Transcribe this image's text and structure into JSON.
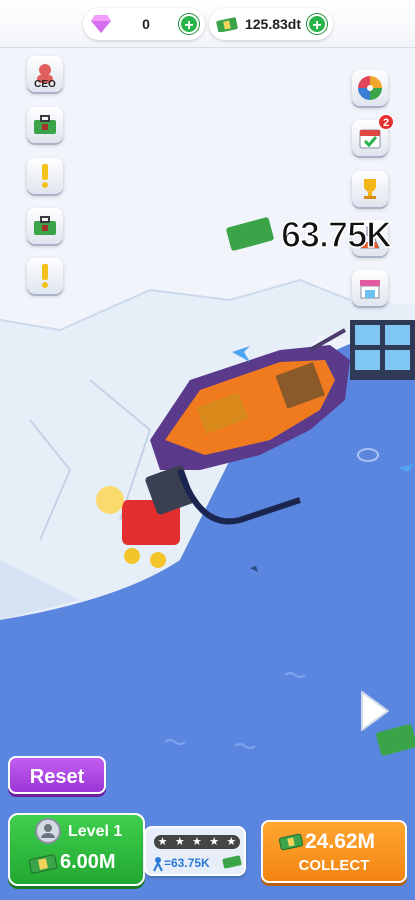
{
  "currency": {
    "gems": "0",
    "cash": "125.83dt",
    "gem_icon": "diamond-icon",
    "cash_icon": "cash-stack-icon"
  },
  "side_left": [
    {
      "name": "ceo-button",
      "label": "CEO"
    },
    {
      "name": "briefcase-button-1",
      "icon": "briefcase-icon"
    },
    {
      "name": "alert-button-1",
      "icon": "exclamation-icon"
    },
    {
      "name": "briefcase-button-2",
      "icon": "briefcase-icon"
    },
    {
      "name": "alert-button-2",
      "icon": "exclamation-icon"
    }
  ],
  "side_right": [
    {
      "name": "wheel-button",
      "icon": "prize-wheel-icon"
    },
    {
      "name": "calendar-button",
      "icon": "calendar-check-icon",
      "badge": "2"
    },
    {
      "name": "trophy-button",
      "icon": "trophy-icon"
    },
    {
      "name": "lab-button",
      "icon": "flask-icon"
    },
    {
      "name": "shop-button",
      "icon": "shop-icon"
    }
  ],
  "floating_income": "63.75K",
  "reset_label": "Reset",
  "level": {
    "label": "Level 1",
    "price": "6.00M"
  },
  "stars": {
    "total": 5,
    "rate": "=63.75K"
  },
  "collect": {
    "amount": "24.62M",
    "label": "COLLECT"
  },
  "colors": {
    "water": "#5b86e0",
    "ice": "#eef3fb",
    "level_green": "#2ab34a",
    "collect_orange": "#f48512",
    "reset_purple": "#b04ae6"
  }
}
